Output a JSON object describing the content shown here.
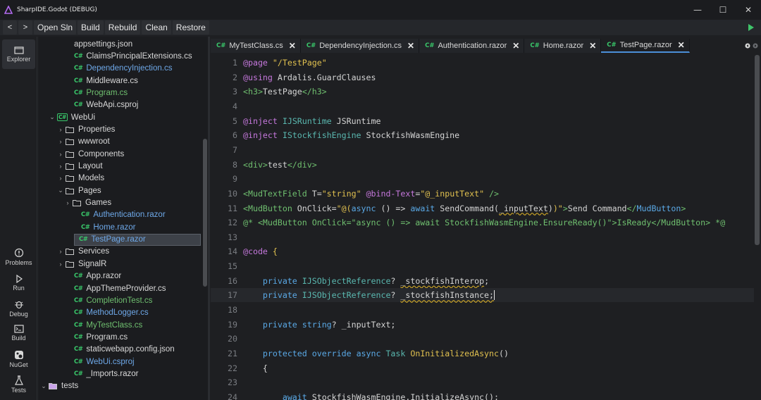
{
  "window": {
    "title": "SharpIDE.Godot (DEBUG)",
    "minimize": "—",
    "maximize": "☐",
    "close": "✕"
  },
  "toolbar": {
    "back": "<",
    "forward": ">",
    "open_sln": "Open Sln",
    "build": "Build",
    "rebuild": "Rebuild",
    "clean": "Clean",
    "restore": "Restore"
  },
  "activity": {
    "explorer": "Explorer",
    "problems": "Problems",
    "run": "Run",
    "debug": "Debug",
    "build": "Build",
    "nuget": "NuGet",
    "tests": "Tests"
  },
  "tree": [
    {
      "label": "appsettings.json",
      "kind": "file",
      "color": "white",
      "indent": 50
    },
    {
      "label": "ClaimsPrincipalExtensions.cs",
      "kind": "cs",
      "color": "white",
      "indent": 50
    },
    {
      "label": "DependencyInjection.cs",
      "kind": "cs",
      "color": "blue",
      "indent": 50
    },
    {
      "label": "Middleware.cs",
      "kind": "cs",
      "color": "white",
      "indent": 50
    },
    {
      "label": "Program.cs",
      "kind": "cs",
      "color": "green",
      "indent": 50
    },
    {
      "label": "WebApi.csproj",
      "kind": "cs",
      "color": "white",
      "indent": 50
    },
    {
      "label": "WebUi",
      "kind": "project",
      "color": "white",
      "indent": 26,
      "chev": "⌄"
    },
    {
      "label": "Properties",
      "kind": "folder",
      "color": "white",
      "indent": 38,
      "chev": "›"
    },
    {
      "label": "wwwroot",
      "kind": "folder",
      "color": "white",
      "indent": 38,
      "chev": "›"
    },
    {
      "label": "Components",
      "kind": "folder",
      "color": "white",
      "indent": 38,
      "chev": "›"
    },
    {
      "label": "Layout",
      "kind": "folder",
      "color": "white",
      "indent": 38,
      "chev": "›"
    },
    {
      "label": "Models",
      "kind": "folder",
      "color": "white",
      "indent": 38,
      "chev": "›"
    },
    {
      "label": "Pages",
      "kind": "folder",
      "color": "white",
      "indent": 38,
      "chev": "⌄"
    },
    {
      "label": "Games",
      "kind": "folder",
      "color": "white",
      "indent": 48,
      "chev": "›"
    },
    {
      "label": "Authentication.razor",
      "kind": "cs",
      "color": "blue",
      "indent": 60
    },
    {
      "label": "Home.razor",
      "kind": "cs",
      "color": "blue",
      "indent": 60
    },
    {
      "label": "TestPage.razor",
      "kind": "cs",
      "color": "sel",
      "indent": 60,
      "selected": true
    },
    {
      "label": "Services",
      "kind": "folder",
      "color": "white",
      "indent": 38,
      "chev": "›"
    },
    {
      "label": "SignalR",
      "kind": "folder",
      "color": "white",
      "indent": 38,
      "chev": "›"
    },
    {
      "label": "App.razor",
      "kind": "cs",
      "color": "white",
      "indent": 50
    },
    {
      "label": "AppThemeProvider.cs",
      "kind": "cs",
      "color": "white",
      "indent": 50
    },
    {
      "label": "CompletionTest.cs",
      "kind": "cs",
      "color": "green",
      "indent": 50
    },
    {
      "label": "MethodLogger.cs",
      "kind": "cs",
      "color": "blue",
      "indent": 50
    },
    {
      "label": "MyTestClass.cs",
      "kind": "cs",
      "color": "green",
      "indent": 50
    },
    {
      "label": "Program.cs",
      "kind": "cs",
      "color": "white",
      "indent": 50
    },
    {
      "label": "staticwebapp.config.json",
      "kind": "cs",
      "color": "white",
      "indent": 50
    },
    {
      "label": "WebUi.csproj",
      "kind": "cs",
      "color": "blue",
      "indent": 50
    },
    {
      "label": "_Imports.razor",
      "kind": "cs",
      "color": "white",
      "indent": 50
    },
    {
      "label": "tests",
      "kind": "folder-special",
      "color": "white",
      "indent": 14,
      "chev": "⌄"
    }
  ],
  "cs_badge": "C#",
  "tabs": [
    {
      "label": "MyTestClass.cs",
      "active": false
    },
    {
      "label": "DependencyInjection.cs",
      "active": false
    },
    {
      "label": "Authentication.razor",
      "active": false
    },
    {
      "label": "Home.razor",
      "active": false
    },
    {
      "label": "TestPage.razor",
      "active": true
    }
  ],
  "tab_close": "✕",
  "code_lines": [
    {
      "n": "1",
      "html": "<span class='kw'>@page</span> <span class='str'>\"/TestPage\"</span>"
    },
    {
      "n": "2",
      "html": "<span class='kw'>@using</span> Ardalis.GuardClauses"
    },
    {
      "n": "3",
      "html": "<span class='tag'>&lt;h3&gt;</span>TestPage<span class='tag'>&lt;/h3&gt;</span>"
    },
    {
      "n": "4",
      "html": ""
    },
    {
      "n": "5",
      "html": "<span class='kw'>@inject</span> <span class='typ'>IJSRuntime</span> JSRuntime"
    },
    {
      "n": "6",
      "html": "<span class='kw'>@inject</span> <span class='typ'>IStockfishEngine</span> StockfishWasmEngine"
    },
    {
      "n": "7",
      "html": ""
    },
    {
      "n": "8",
      "html": "<span class='tag'>&lt;div&gt;</span>test<span class='tag'>&lt;/div&gt;</span>"
    },
    {
      "n": "9",
      "html": ""
    },
    {
      "n": "10",
      "html": "<span class='tag'>&lt;MudTextField</span> T=<span class='str'>\"string\"</span> <span class='kw'>@bind-Text</span>=<span class='str'>\"@_inputText\"</span> <span class='tag'>/&gt;</span>"
    },
    {
      "n": "11",
      "html": "<span class='tag'>&lt;MudButton</span> OnClick=<span class='str'>\"@(</span><span class='kw2'>async</span> () =&gt; <span class='kw2'>await</span> SendCommand(<span class='ul'>_inputText</span>)<span class='str'>)\"</span><span class='tag'>&gt;</span>Send Command<span class='tag'>&lt;/</span><span class='at'>MudButton</span><span class='tag'>&gt;</span>"
    },
    {
      "n": "12",
      "html": "<span class='cm'>@* &lt;MudButton OnClick=\"async () =&gt; await StockfishWasmEngine.EnsureReady()\"&gt;IsReady&lt;/MudButton&gt; *@</span>"
    },
    {
      "n": "13",
      "html": ""
    },
    {
      "n": "14",
      "html": "<span class='kw'>@code</span> <span class='str'>{</span>"
    },
    {
      "n": "15",
      "html": ""
    },
    {
      "n": "16",
      "html": "    <span class='kw2'>private</span> <span class='typ'>IJSObjectReference</span>? <span class='ul'>_stockfishInterop</span>;"
    },
    {
      "n": "17",
      "html": "    <span class='kw2'>private</span> <span class='typ'>IJSObjectReference</span>? <span class='ul cursor'>_stockfishInstance;</span>"
    },
    {
      "n": "18",
      "html": ""
    },
    {
      "n": "19",
      "html": "    <span class='kw2'>private</span> <span class='kw2'>string</span>? _inputText;"
    },
    {
      "n": "20",
      "html": ""
    },
    {
      "n": "21",
      "html": "    <span class='kw2'>protected</span> <span class='kw2'>override</span> <span class='kw2'>async</span> <span class='typ'>Task</span> <span class='str'>OnInitializedAsync</span>()"
    },
    {
      "n": "22",
      "html": "    {"
    },
    {
      "n": "23",
      "html": ""
    },
    {
      "n": "24",
      "html": "        <span class='kw2'>await</span> StockfishWasmEngine.InitializeAsync();"
    }
  ],
  "current_line": 17
}
